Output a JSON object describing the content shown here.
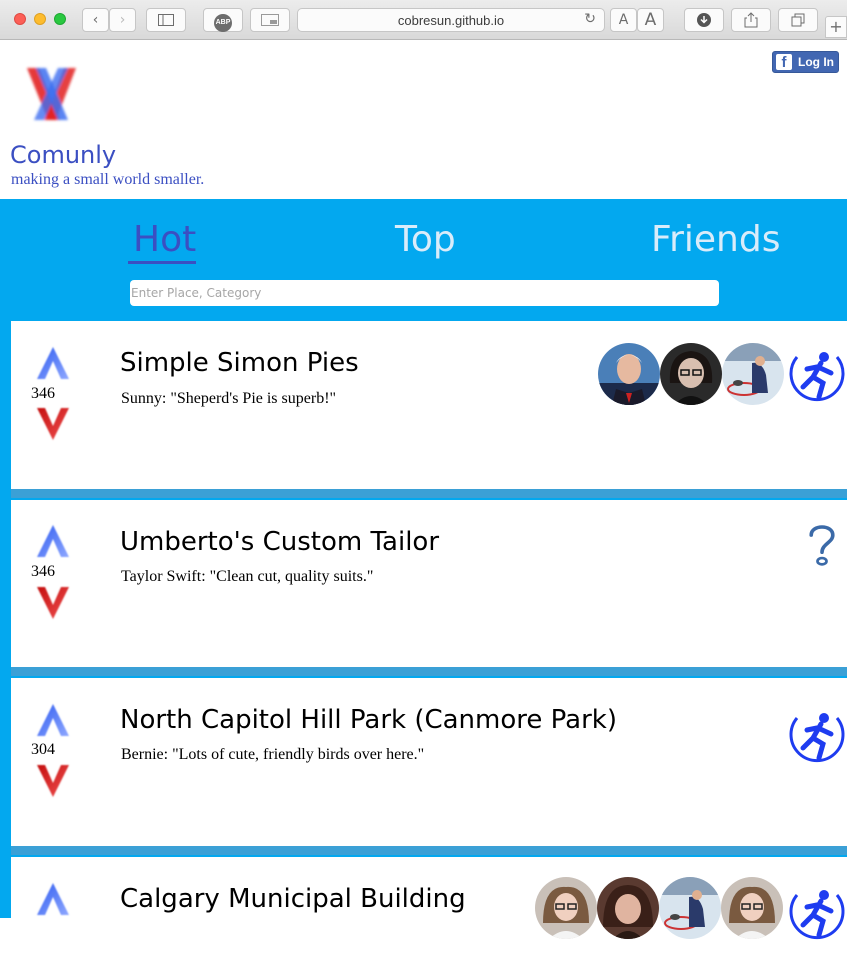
{
  "browser": {
    "url": "cobresun.github.io",
    "adblock_label": "ABP",
    "text_small": "A",
    "text_large": "A",
    "new_tab": "+"
  },
  "header": {
    "login_label": "Log In",
    "fb_glyph": "f",
    "brand": "Comunly",
    "tagline": "making a small world smaller."
  },
  "tabs": [
    {
      "label": "Hot",
      "active": true
    },
    {
      "label": "Top",
      "active": false
    },
    {
      "label": "Friends",
      "active": false
    }
  ],
  "search": {
    "placeholder": "Enter Place, Category",
    "value": ""
  },
  "colors": {
    "accent": "#3b4fc2",
    "background_blue": "#03a8ef",
    "upvote": "#3d6ef0",
    "downvote": "#e02020",
    "facebook": "#4267b2"
  },
  "cards": [
    {
      "count": "346",
      "title": "Simple Simon Pies",
      "quote": "Sunny: \"Sheperd's Pie is superb!\"",
      "icons": [
        "avatar-man",
        "avatar-woman",
        "avatar-curling",
        "activity-runner-icon"
      ]
    },
    {
      "count": "346",
      "title": "Umberto's Custom Tailor",
      "quote": "Taylor Swift: \"Clean cut, quality suits.\"",
      "icons": [
        "question-mark-icon"
      ]
    },
    {
      "count": "304",
      "title": "North Capitol Hill Park (Canmore Park)",
      "quote": "Bernie: \"Lots of cute, friendly birds over here.\"",
      "icons": [
        "activity-runner-icon"
      ]
    },
    {
      "count": "",
      "title": "Calgary Municipal Building",
      "quote": "",
      "icons": [
        "avatar-woman",
        "avatar-woman",
        "avatar-curling",
        "avatar-woman",
        "activity-runner-icon"
      ]
    }
  ]
}
